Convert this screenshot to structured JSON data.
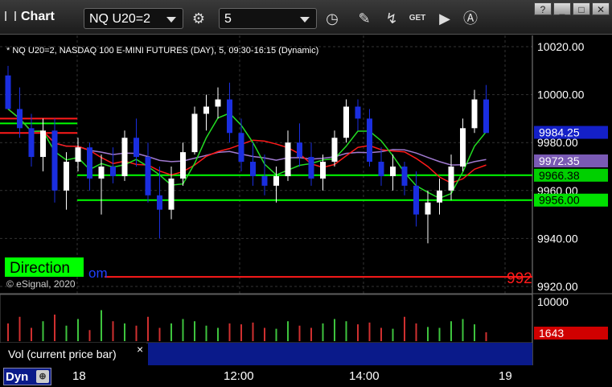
{
  "toolbar": {
    "app_title": "Chart",
    "symbol": "NQ U20=2",
    "interval": "5",
    "icons": [
      "settings-icon",
      "clock-icon",
      "pencil-icon",
      "chart-style-icon",
      "get-icon",
      "play-icon",
      "help-icon"
    ],
    "get_label": "GET",
    "win_restore": "?",
    "win_minimize": "_",
    "win_maximize": "□",
    "win_close": "✕"
  },
  "price_panel": {
    "header": "* NQ U20=2, NASDAQ 100 E-MINI FUTURES (DAY), 5, 09:30-16:15 (Dynamic)",
    "copyright": "© eSignal, 2020",
    "direction_label": "Direction",
    "partial_label": "om",
    "partial_price": "992",
    "y_ticks": [
      "10020.00",
      "10000.00",
      "9980.00",
      "9960.00",
      "9940.00",
      "9920.00"
    ],
    "price_tags": [
      {
        "label": "9984.25",
        "color": "#1420c8"
      },
      {
        "label": "9972.35",
        "color": "#7a5ab4"
      },
      {
        "label": "9966.38",
        "color": "#00d000"
      },
      {
        "label": "9956.00",
        "color": "#00e000"
      }
    ]
  },
  "volume_panel": {
    "label": "Vol (current price bar)",
    "close_icon": "×",
    "y_tick": "10000",
    "tag_label": "1643",
    "tag_color": "#d00000"
  },
  "bottom_bar": {
    "dyn_label": "Dyn",
    "lock_icon": "lock-icon",
    "x_ticks": [
      "18",
      "12:00",
      "14:00",
      "19"
    ]
  },
  "colors": {
    "up": "#ffffff",
    "down": "#1a2ee0",
    "ma_red": "#ff1a1a",
    "ma_green": "#22dd22",
    "ma_purple": "#a07ad0",
    "level_green": "#00ff00",
    "level_red": "#ff1a1a",
    "volume_panel_blue": "#0a1a8a"
  },
  "chart_data": {
    "type": "candlestick",
    "price_axis": [
      9920,
      10020
    ],
    "levels": [
      9966.38,
      9956.0,
      9924
    ],
    "last_price": 9984.25,
    "candles": [
      [
        10008,
        10012,
        10000,
        9994
      ],
      [
        9994,
        10003,
        9982,
        9986
      ],
      [
        9986,
        9992,
        9970,
        9974
      ],
      [
        9974,
        9990,
        9968,
        9985
      ],
      [
        9985,
        9990,
        9955,
        9960
      ],
      [
        9960,
        9976,
        9952,
        9972
      ],
      [
        9972,
        9982,
        9968,
        9978
      ],
      [
        9978,
        9980,
        9960,
        9965
      ],
      [
        9965,
        9975,
        9950,
        9970
      ],
      [
        9970,
        9978,
        9963,
        9966
      ],
      [
        9966,
        9985,
        9964,
        9982
      ],
      [
        9982,
        9990,
        9970,
        9974
      ],
      [
        9974,
        9980,
        9955,
        9958
      ],
      [
        9958,
        9970,
        9940,
        9952
      ],
      [
        9952,
        9970,
        9948,
        9965
      ],
      [
        9965,
        9980,
        9962,
        9976
      ],
      [
        9976,
        9995,
        9975,
        9992
      ],
      [
        9992,
        10000,
        9985,
        9995
      ],
      [
        9995,
        10003,
        9990,
        9998
      ],
      [
        9998,
        10005,
        9980,
        9984
      ],
      [
        9984,
        9990,
        9968,
        9972
      ],
      [
        9972,
        9980,
        9962,
        9966
      ],
      [
        9966,
        9975,
        9958,
        9962
      ],
      [
        9962,
        9970,
        9955,
        9966
      ],
      [
        9966,
        9985,
        9964,
        9980
      ],
      [
        9980,
        9988,
        9970,
        9974
      ],
      [
        9974,
        9980,
        9962,
        9965
      ],
      [
        9965,
        9975,
        9960,
        9972
      ],
      [
        9972,
        9985,
        9970,
        9982
      ],
      [
        9982,
        9998,
        9980,
        9995
      ],
      [
        9995,
        9998,
        9985,
        9990
      ],
      [
        9990,
        9994,
        9970,
        9972
      ],
      [
        9972,
        9978,
        9962,
        9966
      ],
      [
        9966,
        9975,
        9960,
        9970
      ],
      [
        9970,
        9972,
        9958,
        9962
      ],
      [
        9962,
        9968,
        9945,
        9950
      ],
      [
        9950,
        9960,
        9938,
        9955
      ],
      [
        9955,
        9965,
        9950,
        9960
      ],
      [
        9960,
        9975,
        9956,
        9970
      ],
      [
        9970,
        9990,
        9968,
        9986
      ],
      [
        9986,
        10002,
        9984,
        9998
      ],
      [
        9998,
        10004,
        9990,
        9984
      ]
    ],
    "volume": [
      40,
      55,
      30,
      45,
      60,
      35,
      50,
      25,
      70,
      45,
      40,
      35,
      55,
      30,
      40,
      50,
      45,
      35,
      30,
      40,
      38,
      42,
      30,
      28,
      45,
      35,
      30,
      40,
      50,
      45,
      38,
      42,
      30,
      28,
      55,
      40,
      32,
      30,
      45,
      50,
      38,
      20
    ],
    "volume_axis": [
      0,
      16000
    ],
    "last_volume": 1643
  }
}
